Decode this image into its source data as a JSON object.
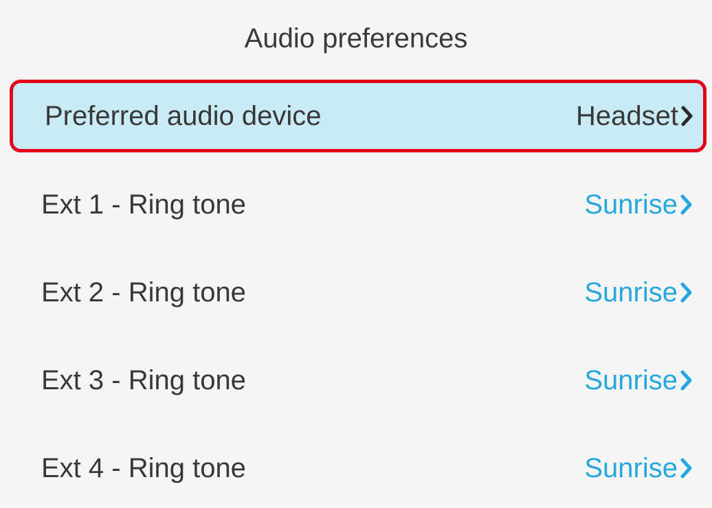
{
  "header": {
    "title": "Audio preferences"
  },
  "menu": {
    "items": [
      {
        "label": "Preferred audio device",
        "value": "Headset",
        "selected": true
      },
      {
        "label": "Ext 1 - Ring tone",
        "value": "Sunrise",
        "selected": false
      },
      {
        "label": "Ext 2 - Ring tone",
        "value": "Sunrise",
        "selected": false
      },
      {
        "label": "Ext 3 - Ring tone",
        "value": "Sunrise",
        "selected": false
      },
      {
        "label": "Ext 4 - Ring tone",
        "value": "Sunrise",
        "selected": false
      }
    ]
  },
  "icons": {
    "row_arrow": "chevron-right-icon"
  },
  "colors": {
    "background": "#f5f5f5",
    "selected_row_bg": "#c9ebf6",
    "highlight_border": "#e3001b",
    "value_link": "#26a8de",
    "text": "#383838"
  }
}
